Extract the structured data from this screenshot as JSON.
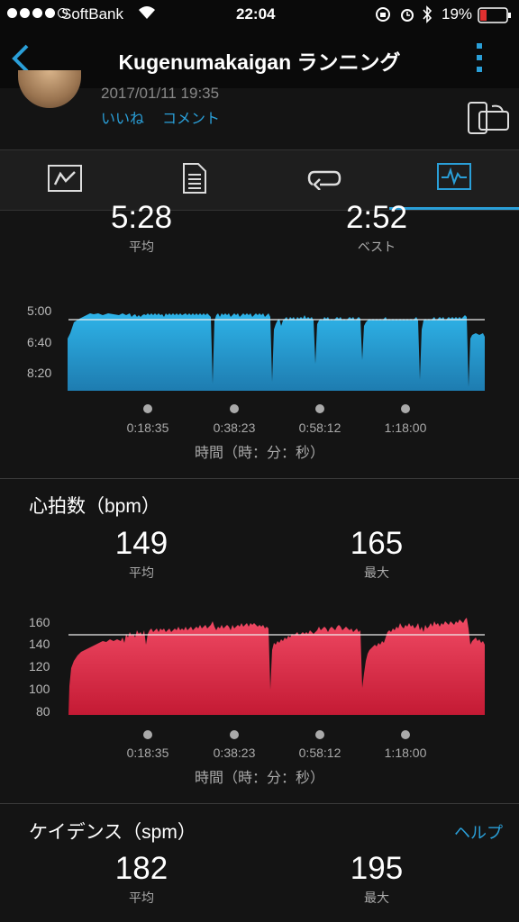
{
  "status": {
    "carrier": "SoftBank",
    "time": "22:04",
    "battery": "19%"
  },
  "nav": {
    "title": "Kugenumakaigan ランニング"
  },
  "activity": {
    "datetime": "2017/01/11 19:35",
    "like": "いいね",
    "comment": "コメント"
  },
  "pace": {
    "avg_value": "5:28",
    "avg_label": "平均",
    "best_value": "2:52",
    "best_label": "ベスト",
    "y_ticks": [
      "5:00",
      "6:40",
      "8:20"
    ],
    "x_ticks": [
      "0:18:35",
      "0:38:23",
      "0:58:12",
      "1:18:00"
    ],
    "x_title": "時間（時：分：秒）"
  },
  "heart": {
    "title": "心拍数（bpm）",
    "avg_value": "149",
    "avg_label": "平均",
    "max_value": "165",
    "max_label": "最大",
    "y_ticks": [
      "160",
      "140",
      "120",
      "100",
      "80"
    ],
    "x_ticks": [
      "0:18:35",
      "0:38:23",
      "0:58:12",
      "1:18:00"
    ],
    "x_title": "時間（時：分：秒）"
  },
  "cadence": {
    "title": "ケイデンス（spm）",
    "help": "ヘルプ",
    "avg_value": "182",
    "avg_label": "平均",
    "max_value": "195",
    "max_label": "最大"
  },
  "colors": {
    "accent": "#2a9fd8",
    "pace_fill": "#2ba7dc",
    "heart_fill": "#e8304f"
  }
}
